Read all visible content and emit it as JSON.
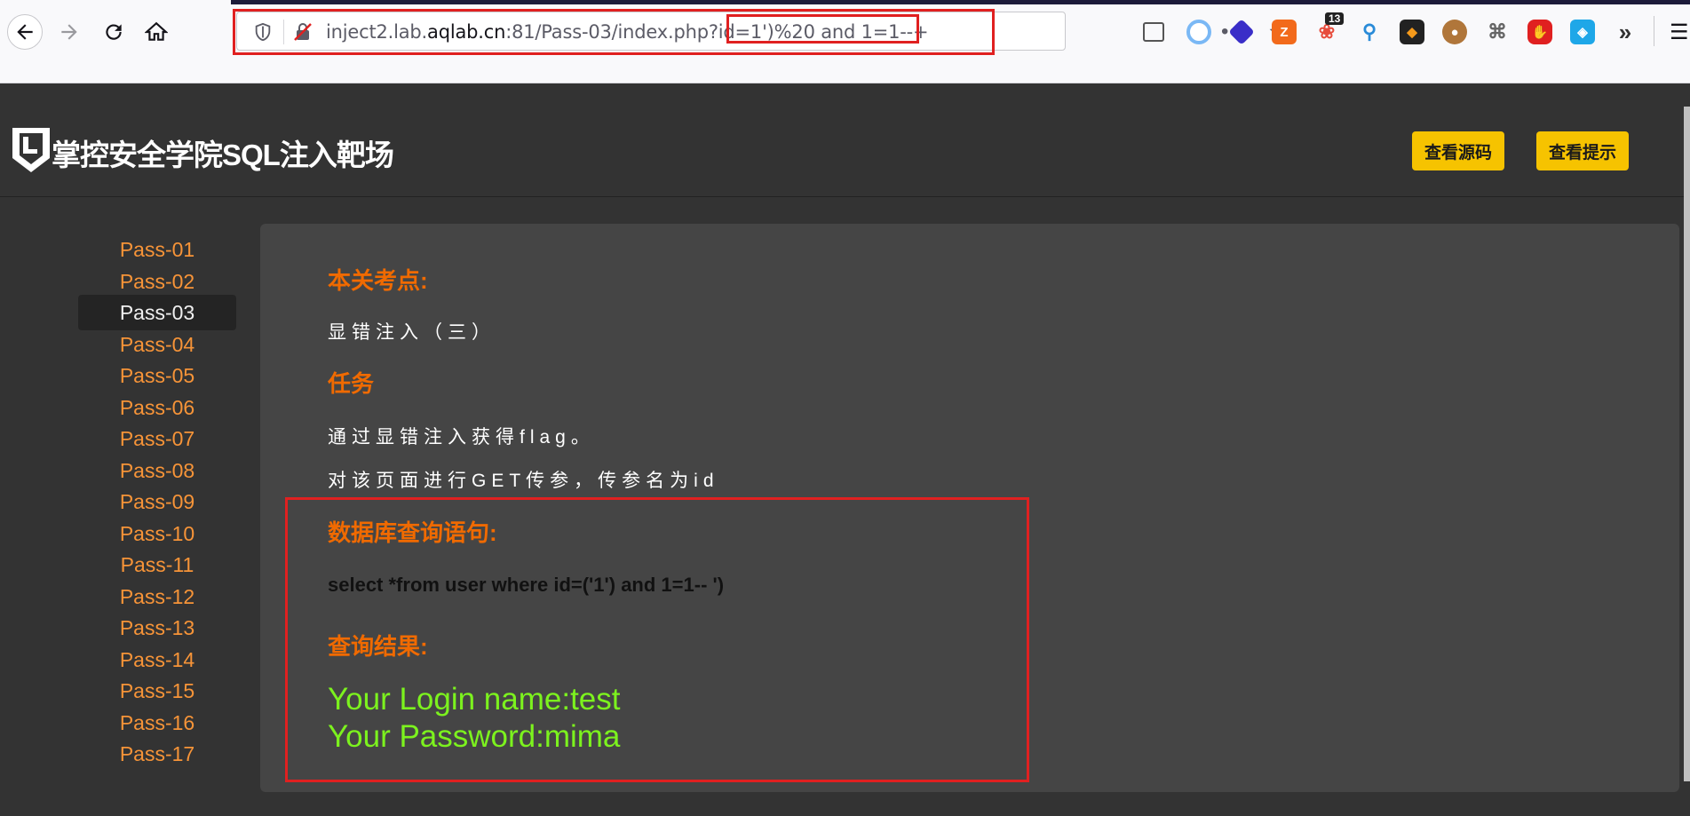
{
  "browser": {
    "url_host_prefix": "inject2.lab.",
    "url_domain": "aqlab.cn",
    "url_rest": ":81/Pass-03/index.php?id=1')%20 and 1=1--+",
    "ext_badge": "13"
  },
  "header": {
    "logo_text": "掌控安全学院SQL注入靶场",
    "btn_source": "查看源码",
    "btn_hint": "查看提示"
  },
  "sidebar": {
    "items": [
      "Pass-01",
      "Pass-02",
      "Pass-03",
      "Pass-04",
      "Pass-05",
      "Pass-06",
      "Pass-07",
      "Pass-08",
      "Pass-09",
      "Pass-10",
      "Pass-11",
      "Pass-12",
      "Pass-13",
      "Pass-14",
      "Pass-15",
      "Pass-16",
      "Pass-17"
    ],
    "active_index": 2
  },
  "main": {
    "focus_title": "本关考点:",
    "focus_text": "显错注入（三）",
    "task_title": "任务",
    "task_line1": "通过显错注入获得flag。",
    "task_line2": "对该页面进行GET传参，传参名为id",
    "sql_title": "数据库查询语句:",
    "sql_text": "select *from user where id=('1') and 1=1-- ')",
    "result_title": "查询结果:",
    "result_line1": "Your Login name:test",
    "result_line2": "Your Password:mima"
  }
}
